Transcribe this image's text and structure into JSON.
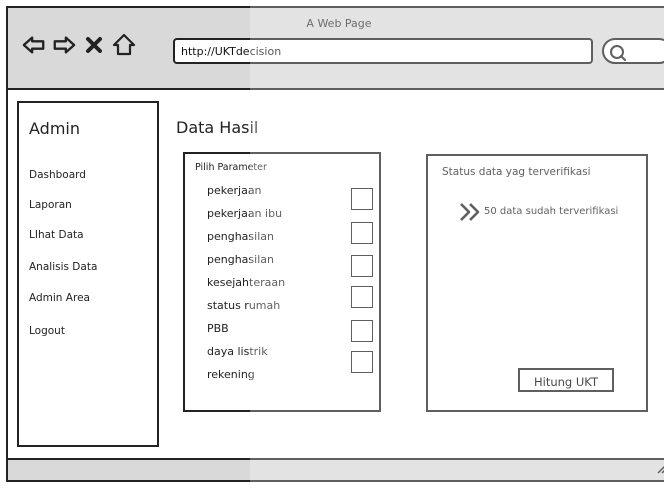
{
  "window": {
    "title": "A Web Page"
  },
  "toolbar": {
    "url": "http://UKTdecision",
    "icons": [
      "back-arrow-icon",
      "forward-arrow-icon",
      "close-x-icon",
      "home-icon",
      "search-icon"
    ]
  },
  "sidebar": {
    "title": "Admin",
    "items": [
      {
        "label": "Dashboard"
      },
      {
        "label": "Laporan"
      },
      {
        "label": "LIhat Data"
      },
      {
        "label": "Analisis Data"
      },
      {
        "label": "Admin Area"
      },
      {
        "label": "Logout"
      }
    ]
  },
  "main": {
    "title": "Data Hasil",
    "parameters": {
      "heading": "Pilih Parameter",
      "items": [
        {
          "label": "pekerjaan"
        },
        {
          "label": "pekerjaan ibu"
        },
        {
          "label": "penghasilan"
        },
        {
          "label": "penghasilan"
        },
        {
          "label": "kesejahteraan"
        },
        {
          "label": "status rumah"
        },
        {
          "label": "PBB"
        },
        {
          "label": "daya listrik"
        },
        {
          "label": "rekening"
        }
      ],
      "checkbox_count": 6
    },
    "status": {
      "heading": "Status data yag terverifikasi",
      "message": "50 data sudah terverifikasi",
      "button_label": "Hitung UKT"
    }
  },
  "colors": {
    "chrome": "#d9d9d9",
    "stroke": "#222222",
    "background": "#ffffff"
  }
}
